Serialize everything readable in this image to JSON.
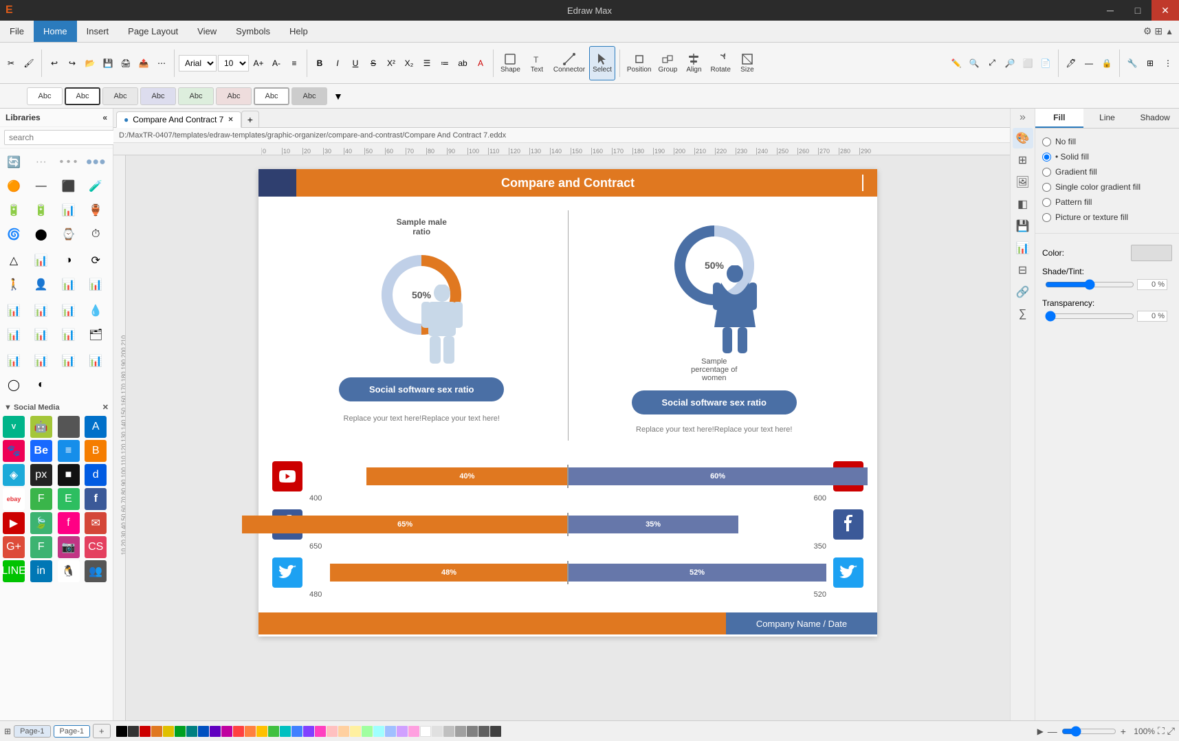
{
  "app": {
    "title": "Edraw Max",
    "icon": "E"
  },
  "titlebar": {
    "minimize": "─",
    "maximize": "□",
    "close": "✕"
  },
  "menubar": {
    "items": [
      "File",
      "Home",
      "Insert",
      "Page Layout",
      "View",
      "Symbols",
      "Help"
    ]
  },
  "toolbar": {
    "font_family": "Arial",
    "font_size": "10",
    "shape_label": "Shape",
    "text_label": "Text",
    "connector_label": "Connector",
    "select_label": "Select",
    "position_label": "Position",
    "group_label": "Group",
    "align_label": "Align",
    "rotate_label": "Rotate",
    "size_label": "Size"
  },
  "style_presets": [
    "Abc",
    "Abc",
    "Abc",
    "Abc",
    "Abc",
    "Abc",
    "Abc",
    "Abc"
  ],
  "left_sidebar": {
    "title": "Libraries",
    "search_placeholder": "search",
    "sections": [
      {
        "label": "Social Media",
        "closeable": true
      }
    ]
  },
  "file_tabs": [
    {
      "label": "Compare And Contract 7",
      "active": true
    },
    {
      "label": "+",
      "active": false
    }
  ],
  "breadcrumb": "D:/MaxTR-0407/templates/edraw-templates/graphic-organizer/compare-and-contrast/Compare And Contract 7.eddx",
  "canvas": {
    "header_title": "Compare and Contract",
    "left_col": {
      "sample_label": "Sample male\nratio",
      "percentage": "50%",
      "social_btn": "Social software sex ratio",
      "replace_text": "Replace your text here!Replace your text here!"
    },
    "right_col": {
      "sample_label": "Sample\npercentage of\nwomen",
      "percentage": "50%",
      "social_btn": "Social software sex ratio",
      "replace_text": "Replace your text here!Replace your text here!"
    },
    "bars": [
      {
        "platform": "YouTube",
        "left_pct": 40,
        "right_pct": 60,
        "left_val": 400,
        "right_val": 600,
        "left_label": "40%",
        "right_label": "60%"
      },
      {
        "platform": "Facebook",
        "left_pct": 65,
        "right_pct": 35,
        "left_val": 650,
        "right_val": 350,
        "left_label": "65%",
        "right_label": "35%"
      },
      {
        "platform": "Twitter",
        "left_pct": 48,
        "right_pct": 52,
        "left_val": 480,
        "right_val": 520,
        "left_label": "48%",
        "right_label": "52%"
      }
    ],
    "footer_text": "Company Name / Date"
  },
  "right_panel": {
    "tabs": [
      "Fill",
      "Line",
      "Shadow"
    ],
    "fill_options": [
      {
        "label": "No fill",
        "selected": false
      },
      {
        "label": "Solid fill",
        "selected": true
      },
      {
        "label": "Gradient fill",
        "selected": false
      },
      {
        "label": "Single color gradient fill",
        "selected": false
      },
      {
        "label": "Pattern fill",
        "selected": false
      },
      {
        "label": "Picture or texture fill",
        "selected": false
      }
    ],
    "color_label": "Color:",
    "shade_tint_label": "Shade/Tint:",
    "shade_value": "0 %",
    "transparency_label": "Transparency:",
    "transparency_value": "0 %"
  },
  "bottom_bar": {
    "page_label": "Page-1",
    "tab_label": "Page-1",
    "add_page": "+",
    "zoom_level": "100%"
  },
  "colors": {
    "orange": "#e07820",
    "blue_dark": "#2f3f6f",
    "blue_mid": "#4a6fa5",
    "blue_bar": "#6677aa",
    "social_btn": "#4a6fa5"
  }
}
